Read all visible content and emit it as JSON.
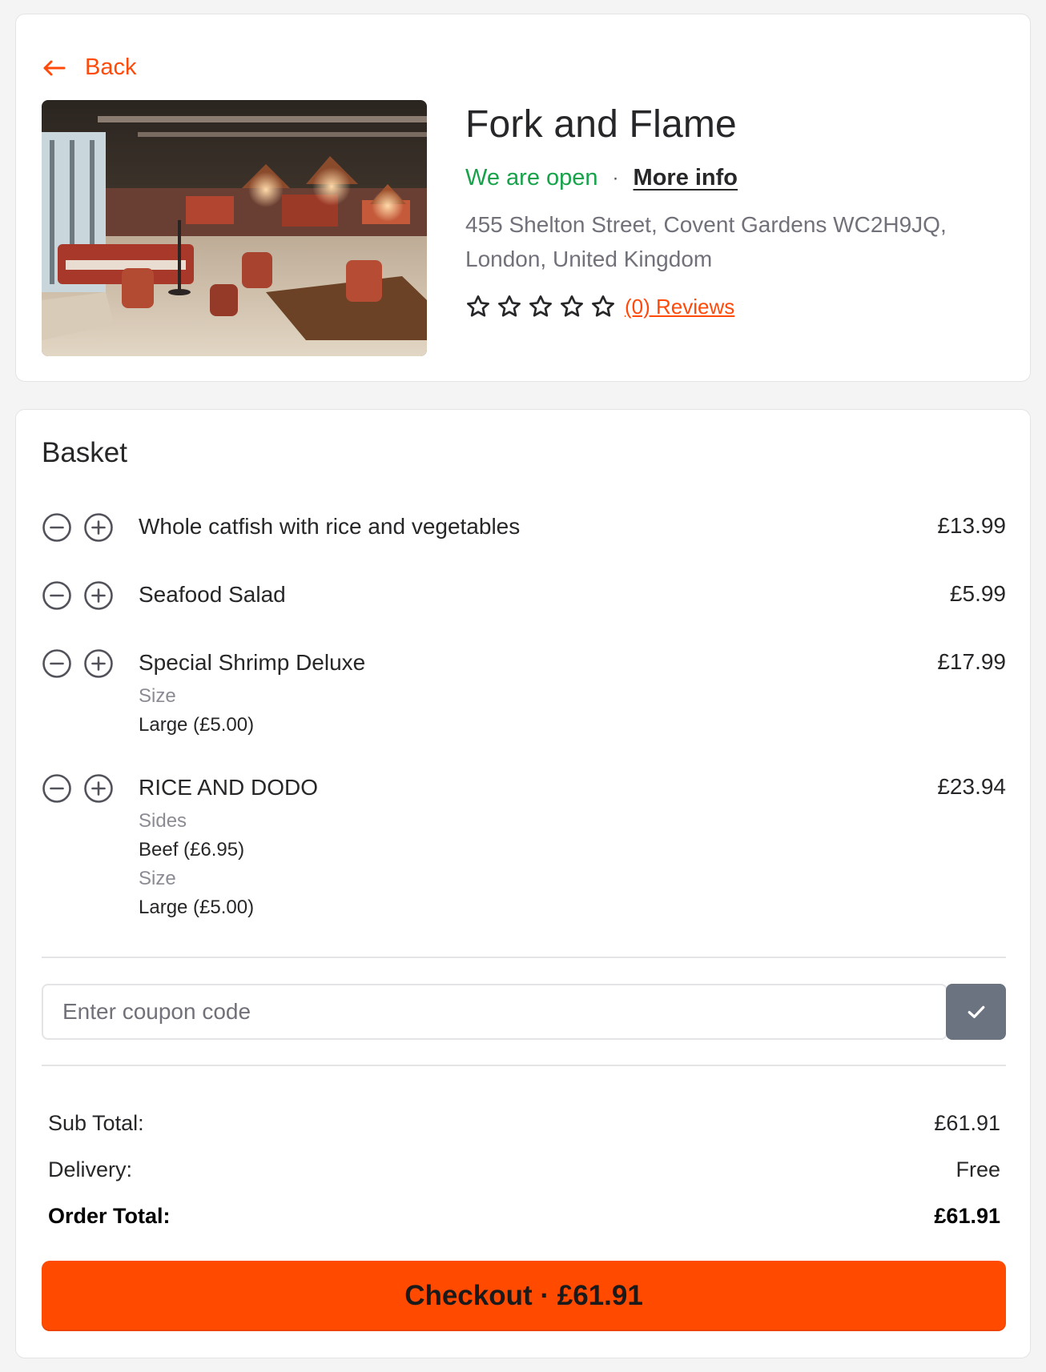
{
  "colors": {
    "accent": "#ff4a0a",
    "open_green": "#16a34a",
    "checkout_bg": "#ff4a00",
    "apply_button_bg": "#6b7280"
  },
  "nav": {
    "back_label": "Back",
    "back_icon": "arrow-left-icon"
  },
  "restaurant": {
    "name": "Fork and Flame",
    "status": "We are open",
    "separator": "·",
    "more_info": "More info",
    "address": "455 Shelton Street, Covent Gardens WC2H9JQ, London, United Kingdom",
    "rating": 0,
    "max_rating": 5,
    "reviews_link": "(0) Reviews"
  },
  "basket": {
    "title": "Basket",
    "items": [
      {
        "name": "Whole catfish with rice and vegetables",
        "price": "£13.99",
        "options": []
      },
      {
        "name": "Seafood Salad",
        "price": "£5.99",
        "options": []
      },
      {
        "name": "Special Shrimp Deluxe",
        "price": "£17.99",
        "options": [
          {
            "label": "Size",
            "value": "Large  (£5.00)"
          }
        ]
      },
      {
        "name": "RICE AND DODO",
        "price": "£23.94",
        "options": [
          {
            "label": "Sides",
            "value": "Beef  (£6.95)"
          },
          {
            "label": "Size",
            "value": "Large  (£5.00)"
          }
        ]
      }
    ],
    "coupon": {
      "placeholder": "Enter coupon code",
      "value": "",
      "apply_icon": "check-icon"
    },
    "totals": {
      "subtotal_label": "Sub Total:",
      "subtotal_value": "£61.91",
      "delivery_label": "Delivery:",
      "delivery_value": "Free",
      "order_total_label": "Order Total:",
      "order_total_value": "£61.91"
    },
    "checkout_label": "Checkout · £61.91"
  }
}
